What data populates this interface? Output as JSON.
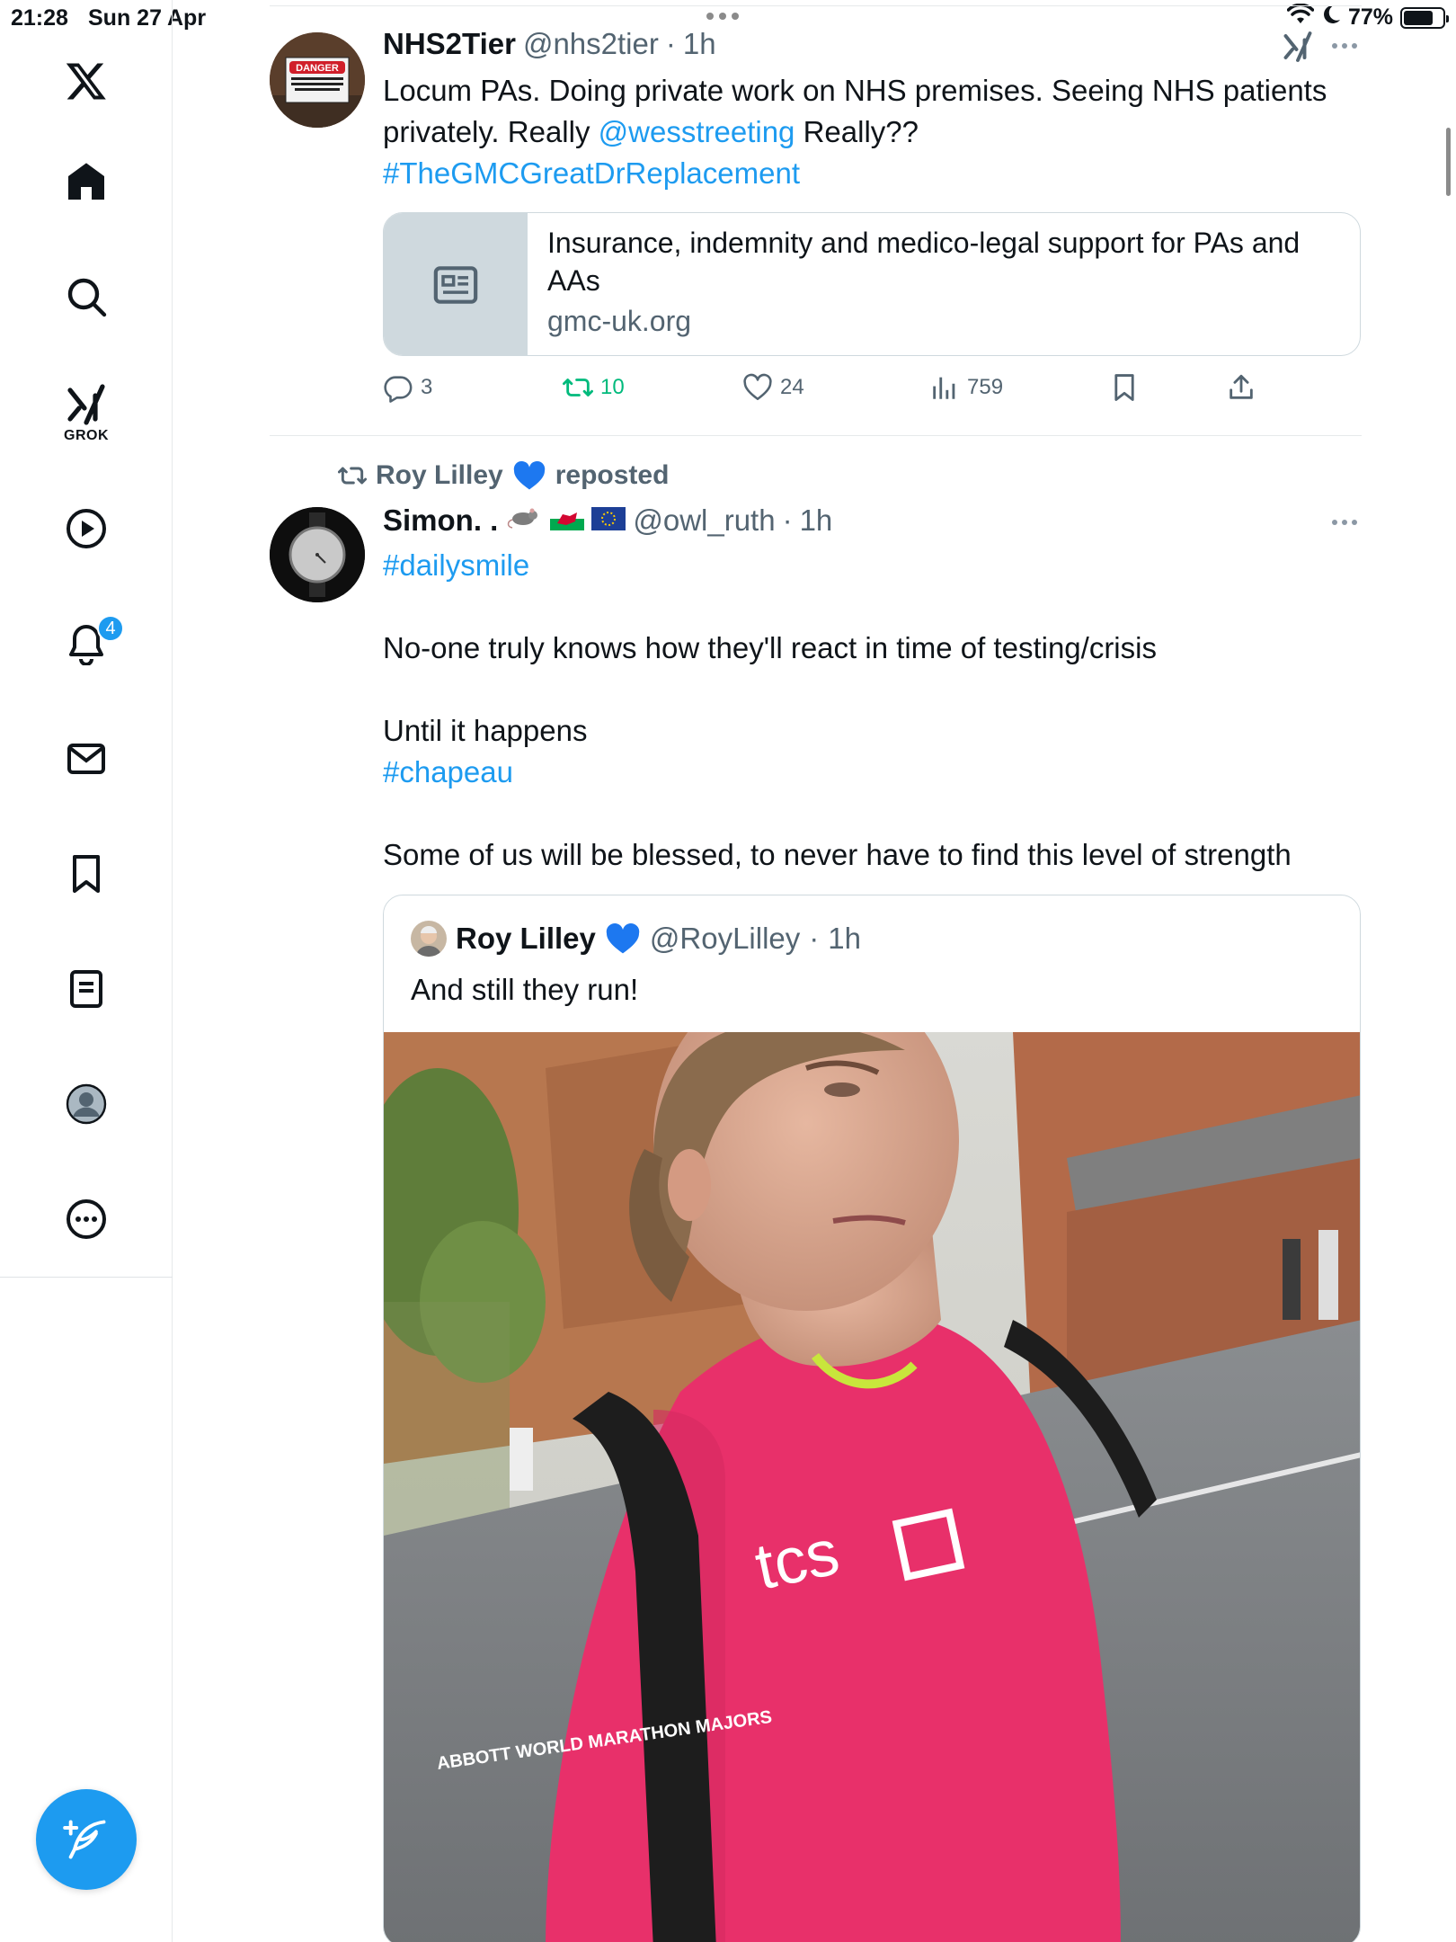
{
  "status_bar": {
    "time": "21:28",
    "date": "Sun 27 Apr",
    "battery": "77%",
    "battery_level": 0.77
  },
  "sidebar": {
    "grok_label": "GROK",
    "notification_count": "4",
    "items": [
      "x-logo",
      "home",
      "search",
      "grok",
      "video",
      "notifications",
      "messages",
      "bookmarks",
      "lists",
      "profile",
      "more"
    ]
  },
  "tweet1": {
    "name": "NHS2Tier",
    "handle": "@nhs2tier",
    "time": "1h",
    "text_before": "Locum PAs. Doing private work on NHS premises. Seeing NHS patients privately. Really ",
    "mention": "@wesstreeting",
    "text_after": " Really??",
    "hashtag": "#TheGMCGreatDrReplacement",
    "card_title": "Insurance, indemnity and medico-legal support for PAs and AAs",
    "card_domain": "gmc-uk.org",
    "replies": "3",
    "retweets": "10",
    "likes": "24",
    "views": "759",
    "avatar_sign": "DANGER",
    "avatar_sign_small": "AUTHORIZED PERSONNEL ONLY BEYOND THIS POINT"
  },
  "tweet2": {
    "reposter": "Roy Lilley",
    "reposted_label": "reposted",
    "name": "Simon. .",
    "handle": "@owl_ruth",
    "time": "1h",
    "hashtag1": "#dailysmile",
    "line1": "No-one truly knows how they'll react in time of testing/crisis",
    "line2": "Until it happens",
    "hashtag2": "#chapeau",
    "line3": "Some of us will be blessed, to never have to find this level of strength"
  },
  "quote": {
    "name": "Roy Lilley",
    "handle": "@RoyLilley",
    "time": "1h",
    "text": "And still they run!",
    "shirt_logo": "tcs",
    "sleeve_text": "ABBOTT WORLD MARATHON MAJORS"
  },
  "colors": {
    "accent": "#1d9bf0",
    "retweet_green": "#00ba7c",
    "secondary_text": "#536471",
    "border": "#cfd9de"
  }
}
